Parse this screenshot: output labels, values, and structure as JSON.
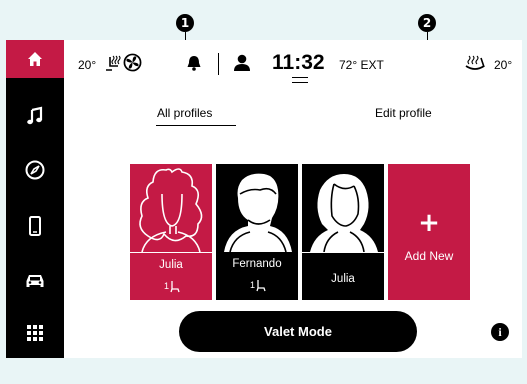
{
  "callouts": [
    "1",
    "2"
  ],
  "status_bar": {
    "left_temp": "20°",
    "time": "11:32",
    "ext_temp": "72° EXT",
    "right_temp": "20°"
  },
  "tabs": {
    "all_profiles": "All profiles",
    "edit_profile": "Edit profile"
  },
  "profiles": [
    {
      "name": "Julia",
      "seat": "1"
    },
    {
      "name": "Fernando",
      "seat": "1"
    },
    {
      "name": "Julia"
    }
  ],
  "add_new": {
    "plus": "+",
    "label": "Add New"
  },
  "valet_mode": "Valet Mode",
  "info": "i",
  "colors": {
    "accent": "#c41a45",
    "sidebar": "#000000",
    "background": "#ffffff",
    "frame": "#e9f5f6"
  },
  "icons": [
    "home-icon",
    "music-icon",
    "compass-icon",
    "phone-icon",
    "car-icon",
    "apps-grid-icon",
    "heated-seat-icon",
    "fan-icon",
    "bell-icon",
    "user-icon",
    "heated-steering-icon",
    "seat-icon",
    "info-icon"
  ]
}
